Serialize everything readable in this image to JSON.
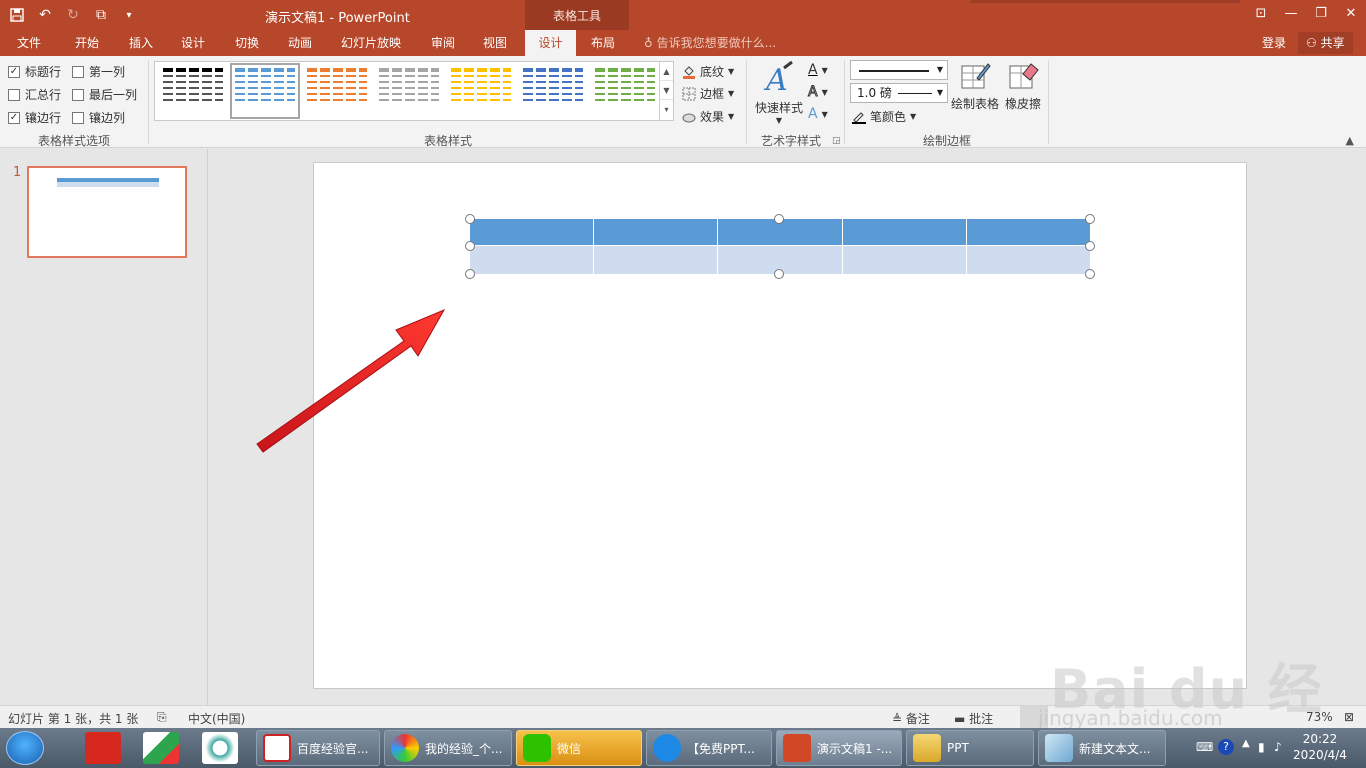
{
  "titlebar": {
    "title": "演示文稿1 - PowerPoint",
    "context_tab_header": "表格工具"
  },
  "tabs": [
    "文件",
    "开始",
    "插入",
    "设计",
    "切换",
    "动画",
    "幻灯片放映",
    "审阅",
    "视图",
    "设计",
    "布局"
  ],
  "active_tab_index": 9,
  "tell_me": "告诉我您想要做什么...",
  "login": "登录",
  "share": "共享",
  "options_group": {
    "label": "表格样式选项",
    "checks": [
      {
        "label": "标题行",
        "checked": true
      },
      {
        "label": "汇总行",
        "checked": false
      },
      {
        "label": "镶边行",
        "checked": true
      },
      {
        "label": "第一列",
        "checked": false
      },
      {
        "label": "最后一列",
        "checked": false
      },
      {
        "label": "镶边列",
        "checked": false
      }
    ]
  },
  "styles_group": {
    "label": "表格样式",
    "thumb_colors": [
      "#000000",
      "#5b9bd5",
      "#ed7d31",
      "#a5a5a5",
      "#ffc000",
      "#4472c4",
      "#70ad47"
    ],
    "selected_index": 1,
    "shading": "底纹",
    "border": "边框",
    "effects": "效果"
  },
  "wordart_group": {
    "label": "艺术字样式",
    "quick_styles": "快速样式",
    "a_glyph": "A"
  },
  "draw_group": {
    "label": "绘制边框",
    "pen_weight": "1.0 磅",
    "pen_color": "笔颜色",
    "draw_table": "绘制表格",
    "eraser": "橡皮擦"
  },
  "thumbs": {
    "slide_number": "1"
  },
  "status": {
    "slide_info": "幻灯片 第 1 张，共 1 张",
    "language": "中文(中国)",
    "notes": "备注",
    "comments": "批注",
    "zoom": "73%"
  },
  "watermark": {
    "logo_text": "Bai du 经验",
    "url": "jingyan.baidu.com"
  },
  "taskbar": {
    "tasks": [
      "百度经验官...",
      "我的经验_个...",
      "微信",
      "【免费PPT...",
      "演示文稿1 -...",
      "PPT",
      "新建文本文..."
    ],
    "time": "20:22",
    "date": "2020/4/4"
  },
  "colors": {
    "accent": "#b7472a",
    "table_header": "#5b9bd5",
    "table_band": "#cfdbee",
    "arrow": "#e8201c"
  }
}
